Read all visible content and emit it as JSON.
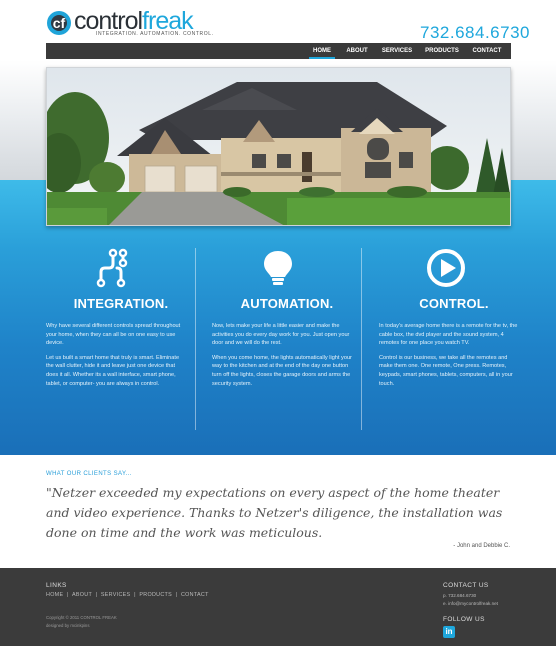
{
  "brand": {
    "logo_control": "control",
    "logo_freak": "freak",
    "logo_mark_letter": "cf",
    "tagline": "INTEGRATION. AUTOMATION. CONTROL.",
    "phone": "732.684.6730"
  },
  "nav": {
    "items": [
      {
        "label": "HOME",
        "active": true
      },
      {
        "label": "ABOUT",
        "active": false
      },
      {
        "label": "SERVICES",
        "active": false
      },
      {
        "label": "PRODUCTS",
        "active": false
      },
      {
        "label": "CONTACT",
        "active": false
      }
    ]
  },
  "hero": {
    "image_subject": "house-photo"
  },
  "features": [
    {
      "icon": "connected-nodes-icon",
      "title": "INTEGRATION.",
      "paragraphs": [
        "Why have several different controls spread throughout your home, when they can all be on one easy to use device.",
        "Let us built a smart home that truly is smart. Eliminate the wall clutter, hide it and leave just one device that does it all. Whether its a wall interface, smart phone, tablet, or computer- you are always in control."
      ]
    },
    {
      "icon": "lightbulb-icon",
      "title": "AUTOMATION.",
      "paragraphs": [
        "Now, lets make your life a little easier and make the activities you do every day work for you. Just open your door and we will do the rest.",
        "When you come home, the lights automatically light your way to the kitchen and at the end of the day one button turn off the lights, closes the garage doors and arms the security system."
      ]
    },
    {
      "icon": "play-circle-icon",
      "title": "CONTROL.",
      "paragraphs": [
        "In today's average home there is a remote for the tv, the cable box, the dvd player and the sound system, 4 remotes for one place you watch TV.",
        "Control is our business, we take all the remotes and make them one. One remote, One press. Remotes, keypads, smart phones, tablets, computers, all in your touch."
      ]
    }
  ],
  "testimonial": {
    "label": "WHAT OUR CLIENTS SAY...",
    "quote": "\"Netzer exceeded my expectations on every aspect of the home theater and video experience. Thanks to Netzer's diligence, the installation was done on time and the work was meticulous.",
    "author": "- John and Debbie C."
  },
  "footer": {
    "links_heading": "LINKS",
    "links": [
      "HOME",
      "ABOUT",
      "SERVICES",
      "PRODUCTS",
      "CONTACT"
    ],
    "copyright": "Copyright © 2011 CONTROL FREAK",
    "designed_by": "designed by mcinkpins",
    "contact_heading": "CONTACT US",
    "contact_phone": "p. 732.684.6730",
    "contact_email": "e. info@mycontrolfreak.net",
    "follow_heading": "FOLLOW US",
    "social_icon": "linkedin-icon",
    "social_letter": "in"
  },
  "colors": {
    "accent": "#1ea7dc",
    "nav_bg": "#3a3a3a",
    "footer_bg": "#3b3b3b",
    "band_top": "#3ebbe9",
    "band_bottom": "#1a6fb8"
  }
}
